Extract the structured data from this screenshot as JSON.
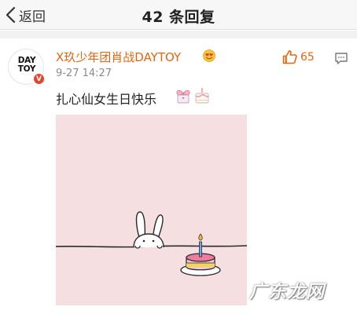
{
  "navbar": {
    "back_label": "返回",
    "title": "42 条回复",
    "back_icon": "chevron-left-icon"
  },
  "comment": {
    "avatar": {
      "logo_line1": "DAY",
      "logo_line2": "TOY",
      "verified_icon": "verified-v-badge",
      "verified_glyph": "V"
    },
    "username": "X玖少年团肖战DAYTOY",
    "user_badge_icon": "heart-eyes-emoji-badge",
    "timestamp": "9-27 14:27",
    "likes": {
      "icon": "thumbs-up-icon",
      "count": "65"
    },
    "reply_icon": "comment-bubble-icon",
    "text": "扎心仙女生日快乐",
    "emojis": [
      "bow-gift-emoji",
      "birthday-cake-emoji"
    ],
    "image": {
      "description_icon": "bunny-and-birthday-cake-illustration",
      "background": "#f5dfe1"
    }
  },
  "watermark": "广东龙网",
  "colors": {
    "accent": "#e8650f",
    "navbar_bg": "#f7f7f7",
    "muted": "#8a8a8a",
    "verified": "#e8432d"
  }
}
